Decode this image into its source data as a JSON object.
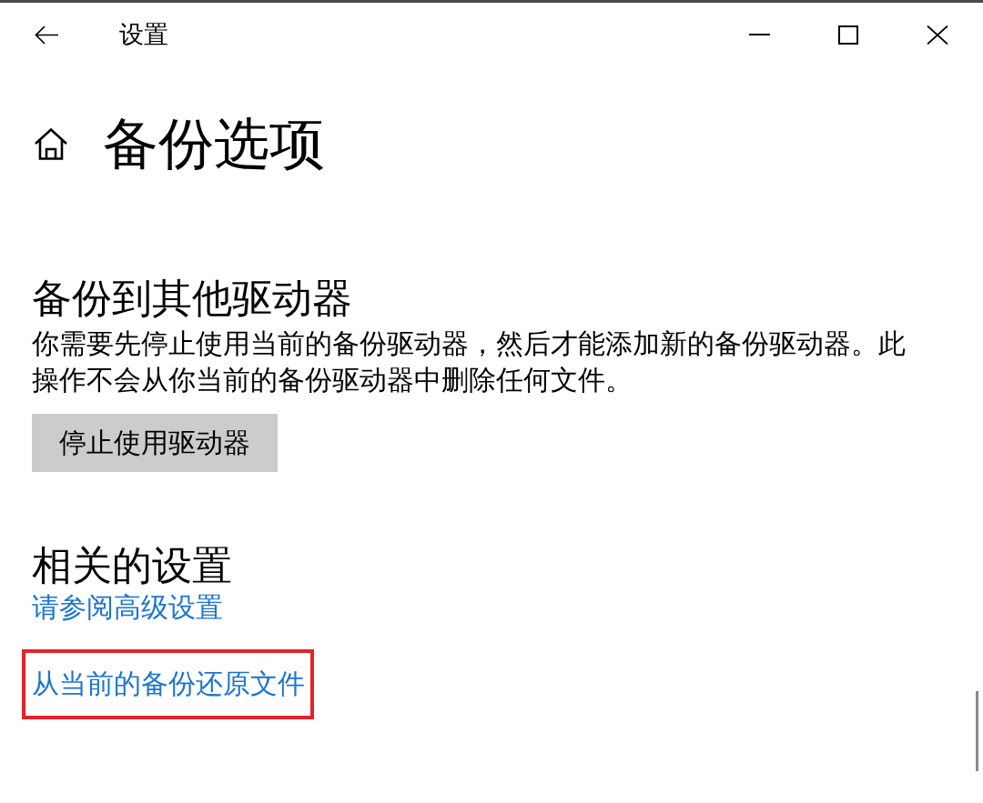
{
  "window": {
    "title": "设置"
  },
  "page": {
    "heading": "备份选项"
  },
  "sections": [
    {
      "kind": "action",
      "heading": "备份到其他驱动器",
      "description": "你需要先停止使用当前的备份驱动器，然后才能添加新的备份驱动器。此操作不会从你当前的备份驱动器中删除任何文件。",
      "button": "停止使用驱动器"
    },
    {
      "kind": "links",
      "heading": "相关的设置",
      "links": [
        {
          "label": "请参阅高级设置",
          "highlighted": false
        },
        {
          "label": "从当前的备份还原文件",
          "highlighted": true
        }
      ]
    }
  ]
}
